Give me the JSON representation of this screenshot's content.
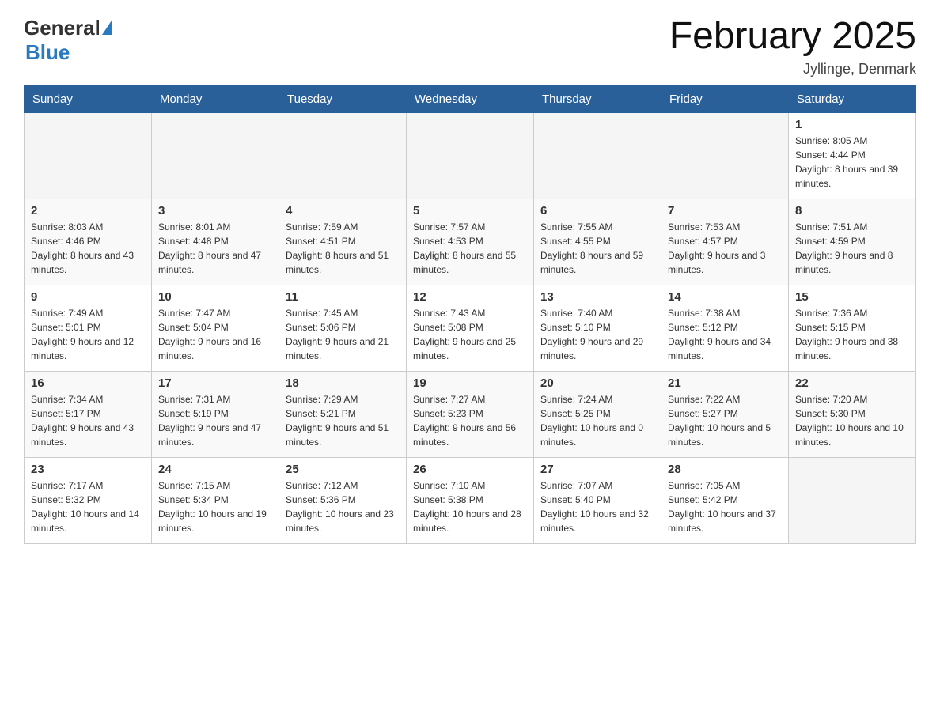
{
  "header": {
    "logo_general": "General",
    "logo_blue": "Blue",
    "month_title": "February 2025",
    "location": "Jyllinge, Denmark"
  },
  "weekdays": [
    "Sunday",
    "Monday",
    "Tuesday",
    "Wednesday",
    "Thursday",
    "Friday",
    "Saturday"
  ],
  "weeks": [
    [
      {
        "day": "",
        "sunrise": "",
        "sunset": "",
        "daylight": ""
      },
      {
        "day": "",
        "sunrise": "",
        "sunset": "",
        "daylight": ""
      },
      {
        "day": "",
        "sunrise": "",
        "sunset": "",
        "daylight": ""
      },
      {
        "day": "",
        "sunrise": "",
        "sunset": "",
        "daylight": ""
      },
      {
        "day": "",
        "sunrise": "",
        "sunset": "",
        "daylight": ""
      },
      {
        "day": "",
        "sunrise": "",
        "sunset": "",
        "daylight": ""
      },
      {
        "day": "1",
        "sunrise": "Sunrise: 8:05 AM",
        "sunset": "Sunset: 4:44 PM",
        "daylight": "Daylight: 8 hours and 39 minutes."
      }
    ],
    [
      {
        "day": "2",
        "sunrise": "Sunrise: 8:03 AM",
        "sunset": "Sunset: 4:46 PM",
        "daylight": "Daylight: 8 hours and 43 minutes."
      },
      {
        "day": "3",
        "sunrise": "Sunrise: 8:01 AM",
        "sunset": "Sunset: 4:48 PM",
        "daylight": "Daylight: 8 hours and 47 minutes."
      },
      {
        "day": "4",
        "sunrise": "Sunrise: 7:59 AM",
        "sunset": "Sunset: 4:51 PM",
        "daylight": "Daylight: 8 hours and 51 minutes."
      },
      {
        "day": "5",
        "sunrise": "Sunrise: 7:57 AM",
        "sunset": "Sunset: 4:53 PM",
        "daylight": "Daylight: 8 hours and 55 minutes."
      },
      {
        "day": "6",
        "sunrise": "Sunrise: 7:55 AM",
        "sunset": "Sunset: 4:55 PM",
        "daylight": "Daylight: 8 hours and 59 minutes."
      },
      {
        "day": "7",
        "sunrise": "Sunrise: 7:53 AM",
        "sunset": "Sunset: 4:57 PM",
        "daylight": "Daylight: 9 hours and 3 minutes."
      },
      {
        "day": "8",
        "sunrise": "Sunrise: 7:51 AM",
        "sunset": "Sunset: 4:59 PM",
        "daylight": "Daylight: 9 hours and 8 minutes."
      }
    ],
    [
      {
        "day": "9",
        "sunrise": "Sunrise: 7:49 AM",
        "sunset": "Sunset: 5:01 PM",
        "daylight": "Daylight: 9 hours and 12 minutes."
      },
      {
        "day": "10",
        "sunrise": "Sunrise: 7:47 AM",
        "sunset": "Sunset: 5:04 PM",
        "daylight": "Daylight: 9 hours and 16 minutes."
      },
      {
        "day": "11",
        "sunrise": "Sunrise: 7:45 AM",
        "sunset": "Sunset: 5:06 PM",
        "daylight": "Daylight: 9 hours and 21 minutes."
      },
      {
        "day": "12",
        "sunrise": "Sunrise: 7:43 AM",
        "sunset": "Sunset: 5:08 PM",
        "daylight": "Daylight: 9 hours and 25 minutes."
      },
      {
        "day": "13",
        "sunrise": "Sunrise: 7:40 AM",
        "sunset": "Sunset: 5:10 PM",
        "daylight": "Daylight: 9 hours and 29 minutes."
      },
      {
        "day": "14",
        "sunrise": "Sunrise: 7:38 AM",
        "sunset": "Sunset: 5:12 PM",
        "daylight": "Daylight: 9 hours and 34 minutes."
      },
      {
        "day": "15",
        "sunrise": "Sunrise: 7:36 AM",
        "sunset": "Sunset: 5:15 PM",
        "daylight": "Daylight: 9 hours and 38 minutes."
      }
    ],
    [
      {
        "day": "16",
        "sunrise": "Sunrise: 7:34 AM",
        "sunset": "Sunset: 5:17 PM",
        "daylight": "Daylight: 9 hours and 43 minutes."
      },
      {
        "day": "17",
        "sunrise": "Sunrise: 7:31 AM",
        "sunset": "Sunset: 5:19 PM",
        "daylight": "Daylight: 9 hours and 47 minutes."
      },
      {
        "day": "18",
        "sunrise": "Sunrise: 7:29 AM",
        "sunset": "Sunset: 5:21 PM",
        "daylight": "Daylight: 9 hours and 51 minutes."
      },
      {
        "day": "19",
        "sunrise": "Sunrise: 7:27 AM",
        "sunset": "Sunset: 5:23 PM",
        "daylight": "Daylight: 9 hours and 56 minutes."
      },
      {
        "day": "20",
        "sunrise": "Sunrise: 7:24 AM",
        "sunset": "Sunset: 5:25 PM",
        "daylight": "Daylight: 10 hours and 0 minutes."
      },
      {
        "day": "21",
        "sunrise": "Sunrise: 7:22 AM",
        "sunset": "Sunset: 5:27 PM",
        "daylight": "Daylight: 10 hours and 5 minutes."
      },
      {
        "day": "22",
        "sunrise": "Sunrise: 7:20 AM",
        "sunset": "Sunset: 5:30 PM",
        "daylight": "Daylight: 10 hours and 10 minutes."
      }
    ],
    [
      {
        "day": "23",
        "sunrise": "Sunrise: 7:17 AM",
        "sunset": "Sunset: 5:32 PM",
        "daylight": "Daylight: 10 hours and 14 minutes."
      },
      {
        "day": "24",
        "sunrise": "Sunrise: 7:15 AM",
        "sunset": "Sunset: 5:34 PM",
        "daylight": "Daylight: 10 hours and 19 minutes."
      },
      {
        "day": "25",
        "sunrise": "Sunrise: 7:12 AM",
        "sunset": "Sunset: 5:36 PM",
        "daylight": "Daylight: 10 hours and 23 minutes."
      },
      {
        "day": "26",
        "sunrise": "Sunrise: 7:10 AM",
        "sunset": "Sunset: 5:38 PM",
        "daylight": "Daylight: 10 hours and 28 minutes."
      },
      {
        "day": "27",
        "sunrise": "Sunrise: 7:07 AM",
        "sunset": "Sunset: 5:40 PM",
        "daylight": "Daylight: 10 hours and 32 minutes."
      },
      {
        "day": "28",
        "sunrise": "Sunrise: 7:05 AM",
        "sunset": "Sunset: 5:42 PM",
        "daylight": "Daylight: 10 hours and 37 minutes."
      },
      {
        "day": "",
        "sunrise": "",
        "sunset": "",
        "daylight": ""
      }
    ]
  ]
}
